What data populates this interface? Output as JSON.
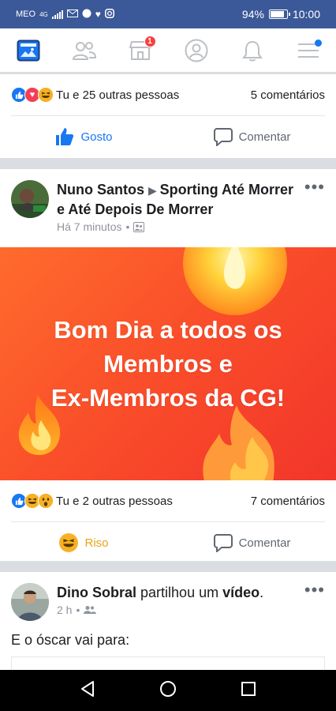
{
  "status_bar": {
    "carrier": "MEO",
    "network": "4G",
    "battery": "94%",
    "battery_level": 0.94,
    "time": "10:00"
  },
  "nav": {
    "items": [
      {
        "name": "news-feed",
        "icon": "news-feed-icon"
      },
      {
        "name": "friends",
        "icon": "friends-icon"
      },
      {
        "name": "marketplace",
        "icon": "marketplace-icon",
        "badge": "1"
      },
      {
        "name": "profile",
        "icon": "profile-icon"
      },
      {
        "name": "notifications",
        "icon": "bell-icon"
      },
      {
        "name": "menu",
        "icon": "hamburger-menu-icon"
      }
    ],
    "accent": "#1877f2"
  },
  "post1": {
    "reactions_text": "Tu e 25 outras pessoas",
    "comments": "5 comentários",
    "like_label": "Gosto",
    "comment_label": "Comentar"
  },
  "post2": {
    "author": "Nuno Santos",
    "group": "Sporting Até Morrer e Até Depois De Morrer",
    "time": "Há 7 minutos",
    "banner_lines": [
      "Bom Dia a  todos os",
      "Membros e",
      "Ex-Membros da CG!"
    ],
    "reactions_text": "Tu e 2 outras pessoas",
    "comments": "7 comentários",
    "react_label": "Riso",
    "comment_label": "Comentar"
  },
  "post3": {
    "author": "Dino Sobral",
    "action": "partilhou um",
    "object": "vídeo",
    "time": "2 h",
    "text": "E o óscar vai para:"
  }
}
